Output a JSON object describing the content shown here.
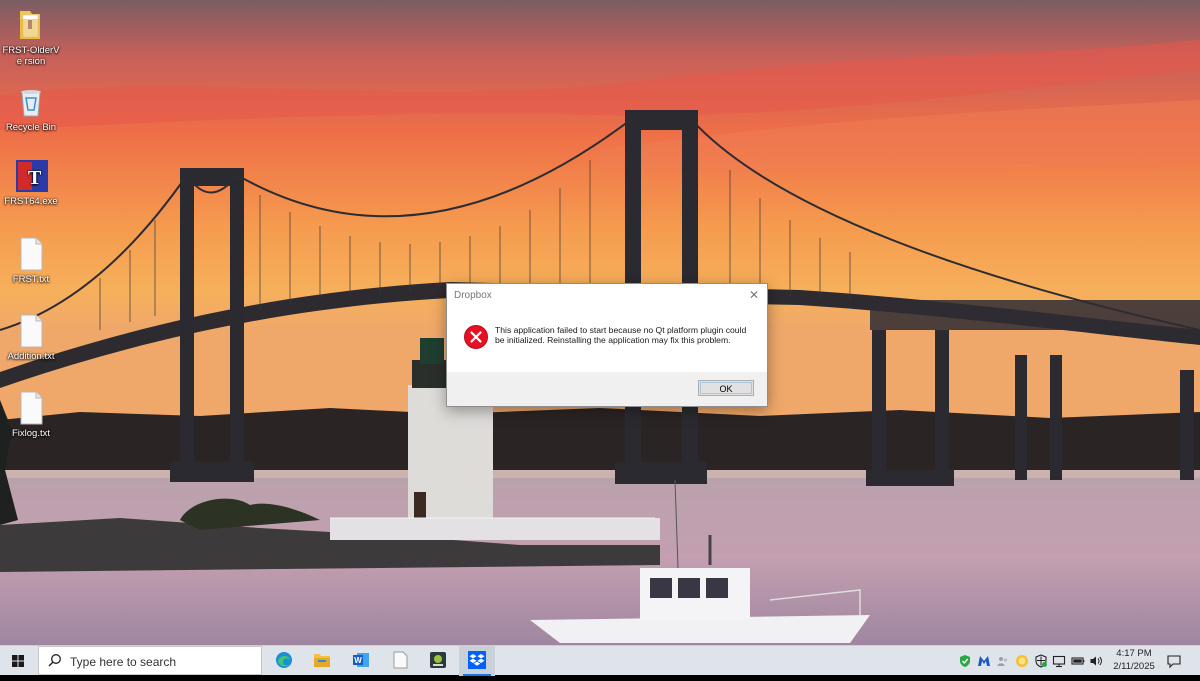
{
  "desktop": {
    "icons": [
      {
        "name": "FRST-OlderVersion folder",
        "label": "FRST-OlderVe rsion",
        "icon": "folder-icon"
      },
      {
        "name": "Recycle Bin",
        "label": "Recycle Bin",
        "icon": "recycle-bin-icon"
      },
      {
        "name": "FRST64.exe",
        "label": "FRST64.exe",
        "icon": "frst-app-icon"
      },
      {
        "name": "FRST.txt",
        "label": "FRST.txt",
        "icon": "text-file-icon"
      },
      {
        "name": "Addition.txt",
        "label": "Addition.txt",
        "icon": "text-file-icon"
      },
      {
        "name": "Fixlog.txt",
        "label": "Fixlog.txt",
        "icon": "text-file-icon"
      }
    ]
  },
  "dialog": {
    "title": "Dropbox",
    "close_glyph": "✕",
    "message": "This application failed to start because no Qt platform plugin could be initialized. Reinstalling the application may fix this problem.",
    "ok_label": "OK",
    "icon": "error-icon"
  },
  "taskbar": {
    "search_placeholder": "Type here to search",
    "apps": [
      "edge-icon",
      "file-explorer-icon",
      "word-icon",
      "notepad-icon",
      "app-icon",
      "dropbox-icon"
    ],
    "active_app": "dropbox-icon",
    "clock": {
      "time": "4:17 PM",
      "date": "2/11/2025"
    }
  },
  "colors": {
    "taskbar": "#dfe3ea",
    "error_red": "#e81123",
    "accent": "#0078d7"
  }
}
